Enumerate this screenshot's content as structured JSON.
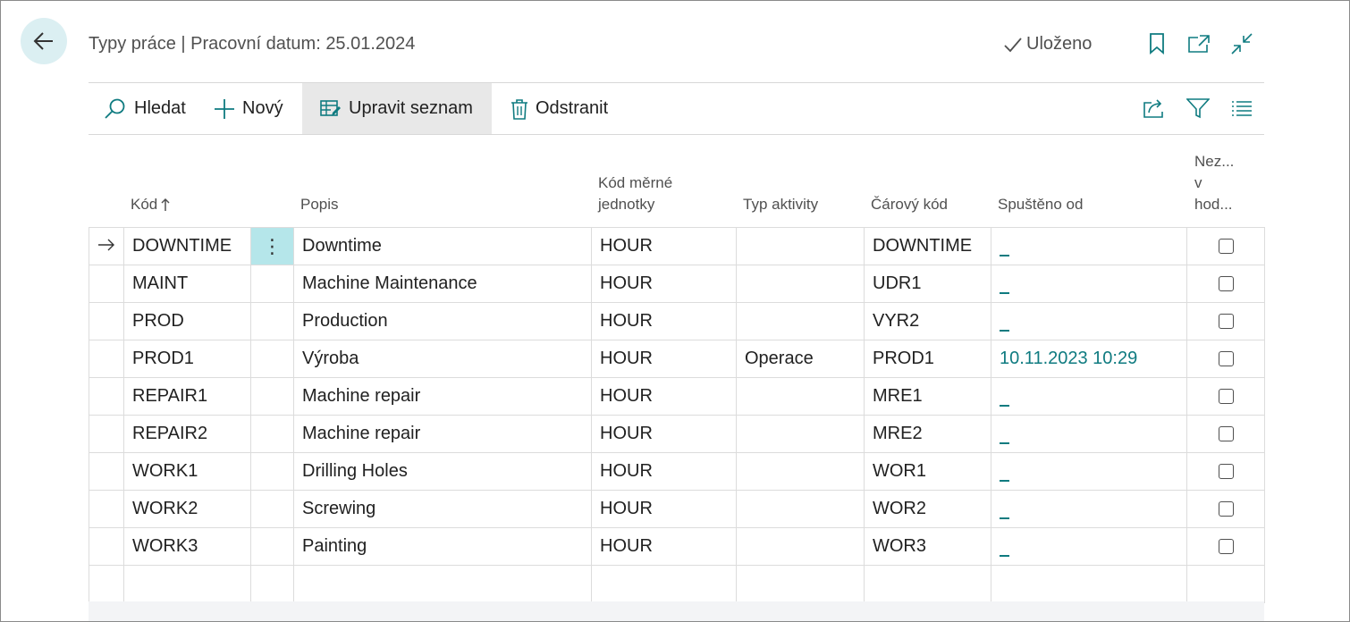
{
  "header": {
    "title": "Typy práce | Pracovní datum: 25.01.2024",
    "saved_label": "Uloženo"
  },
  "actions": {
    "search": "Hledat",
    "new": "Nový",
    "edit_list": "Upravit seznam",
    "delete": "Odstranit"
  },
  "columns": {
    "code": "Kód",
    "description": "Popis",
    "uom_line1": "Kód měrné",
    "uom_line2": "jednotky",
    "activity_type": "Typ aktivity",
    "barcode": "Čárový kód",
    "started_from": "Spuštěno od",
    "blocked_line1": "Nez...",
    "blocked_line2": "v",
    "blocked_line3": "hod..."
  },
  "rows": [
    {
      "code": "DOWNTIME",
      "description": "Downtime",
      "uom": "HOUR",
      "activity": "",
      "barcode": "DOWNTIME",
      "started": "",
      "blocked": false,
      "current": true
    },
    {
      "code": "MAINT",
      "description": "Machine Maintenance",
      "uom": "HOUR",
      "activity": "",
      "barcode": "UDR1",
      "started": "",
      "blocked": false
    },
    {
      "code": "PROD",
      "description": "Production",
      "uom": "HOUR",
      "activity": "",
      "barcode": "VYR2",
      "started": "",
      "blocked": false
    },
    {
      "code": "PROD1",
      "description": "Výroba",
      "uom": "HOUR",
      "activity": "Operace",
      "barcode": "PROD1",
      "started": "10.11.2023 10:29",
      "blocked": false
    },
    {
      "code": "REPAIR1",
      "description": "Machine repair",
      "uom": "HOUR",
      "activity": "",
      "barcode": "MRE1",
      "started": "",
      "blocked": false
    },
    {
      "code": "REPAIR2",
      "description": "Machine repair",
      "uom": "HOUR",
      "activity": "",
      "barcode": "MRE2",
      "started": "",
      "blocked": false
    },
    {
      "code": "WORK1",
      "description": "Drilling Holes",
      "uom": "HOUR",
      "activity": "",
      "barcode": "WOR1",
      "started": "",
      "blocked": false
    },
    {
      "code": "WORK2",
      "description": "Screwing",
      "uom": "HOUR",
      "activity": "",
      "barcode": "WOR2",
      "started": "",
      "blocked": false
    },
    {
      "code": "WORK3",
      "description": "Painting",
      "uom": "HOUR",
      "activity": "",
      "barcode": "WOR3",
      "started": "",
      "blocked": false
    }
  ],
  "icons": {
    "back": "arrow-left-icon",
    "bookmark": "bookmark-icon",
    "open_new": "open-in-new-window-icon",
    "collapse": "collapse-icon",
    "search": "search-icon",
    "new": "plus-icon",
    "edit_list": "edit-list-icon",
    "delete": "trash-icon",
    "share": "share-icon",
    "filter": "filter-icon",
    "list": "list-view-icon",
    "sort": "sort-ascending-icon"
  },
  "colors": {
    "accent": "#0f7b80",
    "back_button_bg": "#dbeff2",
    "active_cell": "#b5e6ea"
  }
}
